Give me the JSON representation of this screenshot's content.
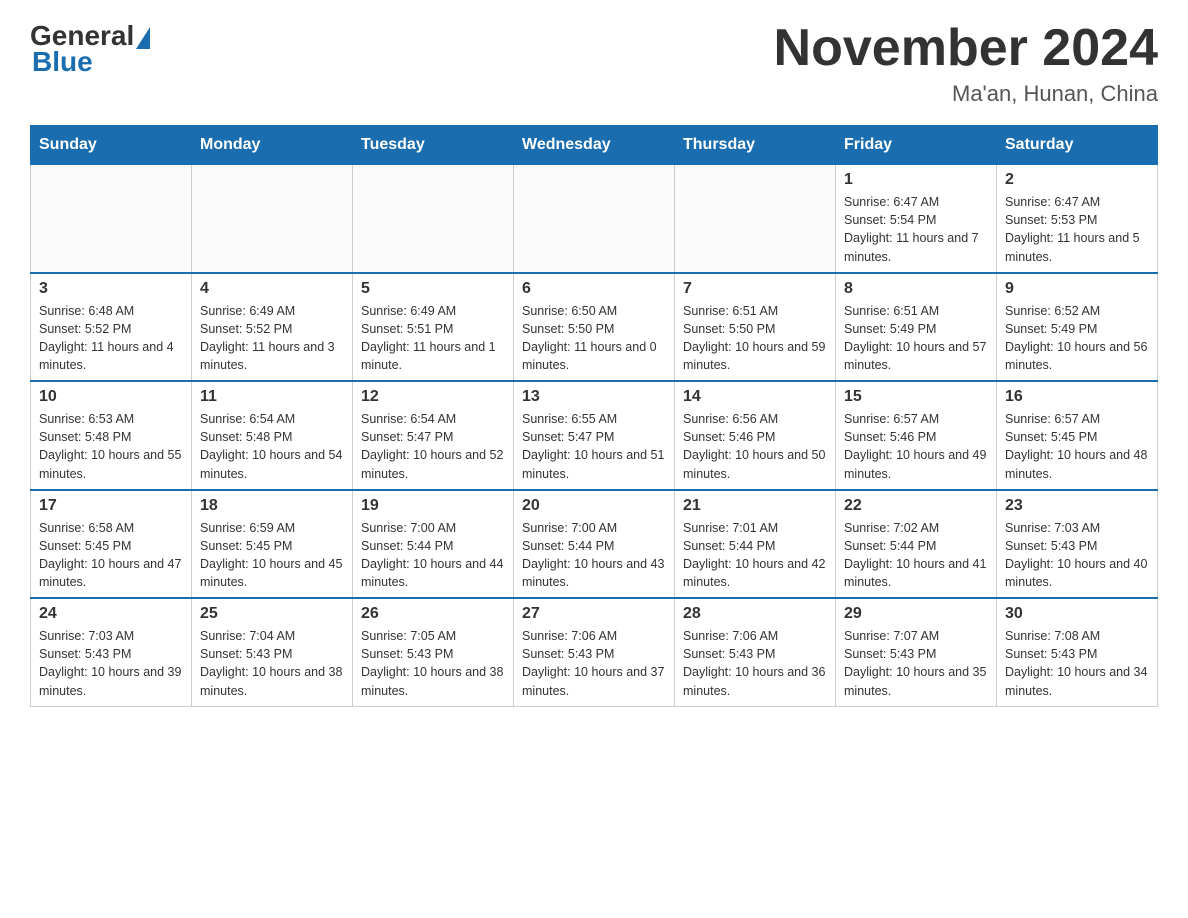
{
  "header": {
    "logo_general": "General",
    "logo_blue": "Blue",
    "month_title": "November 2024",
    "location": "Ma'an, Hunan, China"
  },
  "weekdays": [
    "Sunday",
    "Monday",
    "Tuesday",
    "Wednesday",
    "Thursday",
    "Friday",
    "Saturday"
  ],
  "weeks": [
    [
      {
        "day": "",
        "info": ""
      },
      {
        "day": "",
        "info": ""
      },
      {
        "day": "",
        "info": ""
      },
      {
        "day": "",
        "info": ""
      },
      {
        "day": "",
        "info": ""
      },
      {
        "day": "1",
        "info": "Sunrise: 6:47 AM\nSunset: 5:54 PM\nDaylight: 11 hours and 7 minutes."
      },
      {
        "day": "2",
        "info": "Sunrise: 6:47 AM\nSunset: 5:53 PM\nDaylight: 11 hours and 5 minutes."
      }
    ],
    [
      {
        "day": "3",
        "info": "Sunrise: 6:48 AM\nSunset: 5:52 PM\nDaylight: 11 hours and 4 minutes."
      },
      {
        "day": "4",
        "info": "Sunrise: 6:49 AM\nSunset: 5:52 PM\nDaylight: 11 hours and 3 minutes."
      },
      {
        "day": "5",
        "info": "Sunrise: 6:49 AM\nSunset: 5:51 PM\nDaylight: 11 hours and 1 minute."
      },
      {
        "day": "6",
        "info": "Sunrise: 6:50 AM\nSunset: 5:50 PM\nDaylight: 11 hours and 0 minutes."
      },
      {
        "day": "7",
        "info": "Sunrise: 6:51 AM\nSunset: 5:50 PM\nDaylight: 10 hours and 59 minutes."
      },
      {
        "day": "8",
        "info": "Sunrise: 6:51 AM\nSunset: 5:49 PM\nDaylight: 10 hours and 57 minutes."
      },
      {
        "day": "9",
        "info": "Sunrise: 6:52 AM\nSunset: 5:49 PM\nDaylight: 10 hours and 56 minutes."
      }
    ],
    [
      {
        "day": "10",
        "info": "Sunrise: 6:53 AM\nSunset: 5:48 PM\nDaylight: 10 hours and 55 minutes."
      },
      {
        "day": "11",
        "info": "Sunrise: 6:54 AM\nSunset: 5:48 PM\nDaylight: 10 hours and 54 minutes."
      },
      {
        "day": "12",
        "info": "Sunrise: 6:54 AM\nSunset: 5:47 PM\nDaylight: 10 hours and 52 minutes."
      },
      {
        "day": "13",
        "info": "Sunrise: 6:55 AM\nSunset: 5:47 PM\nDaylight: 10 hours and 51 minutes."
      },
      {
        "day": "14",
        "info": "Sunrise: 6:56 AM\nSunset: 5:46 PM\nDaylight: 10 hours and 50 minutes."
      },
      {
        "day": "15",
        "info": "Sunrise: 6:57 AM\nSunset: 5:46 PM\nDaylight: 10 hours and 49 minutes."
      },
      {
        "day": "16",
        "info": "Sunrise: 6:57 AM\nSunset: 5:45 PM\nDaylight: 10 hours and 48 minutes."
      }
    ],
    [
      {
        "day": "17",
        "info": "Sunrise: 6:58 AM\nSunset: 5:45 PM\nDaylight: 10 hours and 47 minutes."
      },
      {
        "day": "18",
        "info": "Sunrise: 6:59 AM\nSunset: 5:45 PM\nDaylight: 10 hours and 45 minutes."
      },
      {
        "day": "19",
        "info": "Sunrise: 7:00 AM\nSunset: 5:44 PM\nDaylight: 10 hours and 44 minutes."
      },
      {
        "day": "20",
        "info": "Sunrise: 7:00 AM\nSunset: 5:44 PM\nDaylight: 10 hours and 43 minutes."
      },
      {
        "day": "21",
        "info": "Sunrise: 7:01 AM\nSunset: 5:44 PM\nDaylight: 10 hours and 42 minutes."
      },
      {
        "day": "22",
        "info": "Sunrise: 7:02 AM\nSunset: 5:44 PM\nDaylight: 10 hours and 41 minutes."
      },
      {
        "day": "23",
        "info": "Sunrise: 7:03 AM\nSunset: 5:43 PM\nDaylight: 10 hours and 40 minutes."
      }
    ],
    [
      {
        "day": "24",
        "info": "Sunrise: 7:03 AM\nSunset: 5:43 PM\nDaylight: 10 hours and 39 minutes."
      },
      {
        "day": "25",
        "info": "Sunrise: 7:04 AM\nSunset: 5:43 PM\nDaylight: 10 hours and 38 minutes."
      },
      {
        "day": "26",
        "info": "Sunrise: 7:05 AM\nSunset: 5:43 PM\nDaylight: 10 hours and 38 minutes."
      },
      {
        "day": "27",
        "info": "Sunrise: 7:06 AM\nSunset: 5:43 PM\nDaylight: 10 hours and 37 minutes."
      },
      {
        "day": "28",
        "info": "Sunrise: 7:06 AM\nSunset: 5:43 PM\nDaylight: 10 hours and 36 minutes."
      },
      {
        "day": "29",
        "info": "Sunrise: 7:07 AM\nSunset: 5:43 PM\nDaylight: 10 hours and 35 minutes."
      },
      {
        "day": "30",
        "info": "Sunrise: 7:08 AM\nSunset: 5:43 PM\nDaylight: 10 hours and 34 minutes."
      }
    ]
  ]
}
